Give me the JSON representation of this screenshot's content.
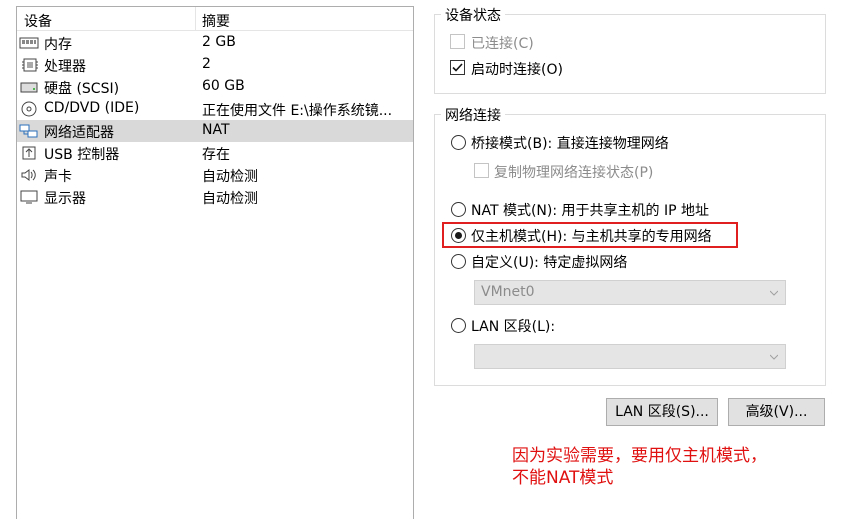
{
  "device_list": {
    "header_device": "设备",
    "header_summary": "摘要",
    "items": [
      {
        "icon": "memory-icon",
        "name": "内存",
        "summary": "2 GB",
        "selected": false
      },
      {
        "icon": "processor-icon",
        "name": "处理器",
        "summary": "2",
        "selected": false
      },
      {
        "icon": "hard-disk-icon",
        "name": "硬盘 (SCSI)",
        "summary": "60 GB",
        "selected": false
      },
      {
        "icon": "cd-dvd-icon",
        "name": "CD/DVD (IDE)",
        "summary": "正在使用文件 E:\\操作系统镜...",
        "selected": false
      },
      {
        "icon": "network-adapter-icon",
        "name": "网络适配器",
        "summary": "NAT",
        "selected": true
      },
      {
        "icon": "usb-icon",
        "name": "USB 控制器",
        "summary": "存在",
        "selected": false
      },
      {
        "icon": "sound-icon",
        "name": "声卡",
        "summary": "自动检测",
        "selected": false
      },
      {
        "icon": "display-icon",
        "name": "显示器",
        "summary": "自动检测",
        "selected": false
      }
    ]
  },
  "device_status": {
    "title": "设备状态",
    "connected_label": "已连接(C)",
    "connected_checked": false,
    "connect_on_power_label": "启动时连接(O)",
    "connect_on_power_checked": true
  },
  "network": {
    "title": "网络连接",
    "bridged_label": "桥接模式(B): 直接连接物理网络",
    "replicate_label": "复制物理网络连接状态(P)",
    "nat_label": "NAT 模式(N): 用于共享主机的 IP 地址",
    "host_only_label": "仅主机模式(H): 与主机共享的专用网络",
    "custom_label": "自定义(U): 特定虚拟网络",
    "custom_dropdown_value": "VMnet0",
    "lan_label": "LAN 区段(L):",
    "lan_dropdown_value": "",
    "selected": "host_only"
  },
  "buttons": {
    "lan_segments": "LAN 区段(S)...",
    "advanced": "高级(V)..."
  },
  "annotation": {
    "line1": "因为实验需要，要用仅主机模式，",
    "line2": "不能NAT模式"
  },
  "colors": {
    "highlight": "#e02020",
    "annotation": "#e01010",
    "selected_row": "#d9d9d9"
  }
}
